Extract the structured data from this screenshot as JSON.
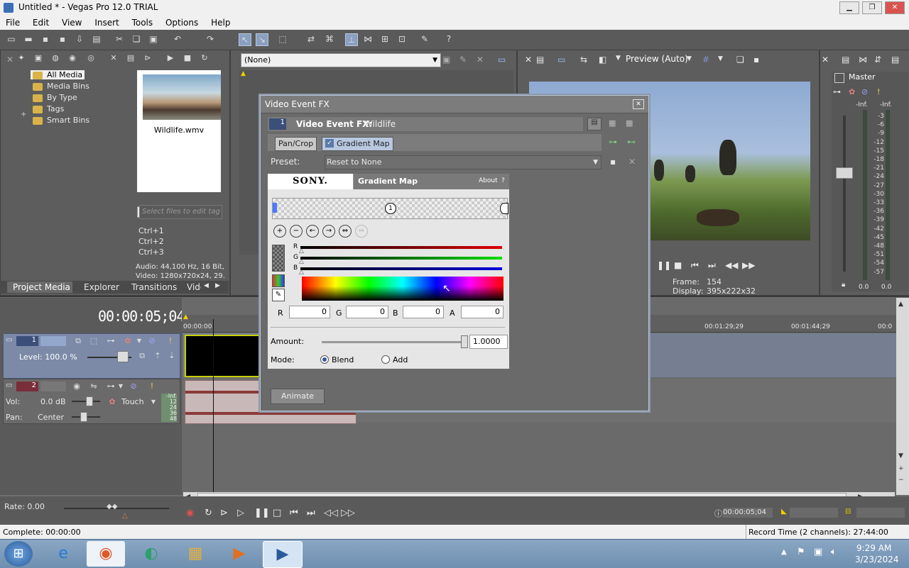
{
  "window": {
    "title": "Untitled * - Vegas Pro 12.0 TRIAL"
  },
  "menu": [
    "File",
    "Edit",
    "View",
    "Insert",
    "Tools",
    "Options",
    "Help"
  ],
  "media_tree": {
    "items": [
      "All Media",
      "Media Bins",
      "By Type",
      "Tags",
      "Smart Bins"
    ],
    "expand_sign": "+"
  },
  "media_thumb": {
    "filename": "Wildlife.wmv"
  },
  "media_tag_search": {
    "placeholder": "Select files to edit tag"
  },
  "shortcuts": [
    "Ctrl+1",
    "Ctrl+2",
    "Ctrl+3"
  ],
  "media_info": {
    "audio": "Audio: 44,100 Hz, 16 Bit,",
    "video": "Video: 1280x720x24, 29."
  },
  "window_tabs": [
    "Project Media",
    "Explorer",
    "Transitions",
    "Vide"
  ],
  "fx_dropdown": {
    "value": "(None)"
  },
  "preview": {
    "quality": "Preview (Auto)",
    "frame_label": "Frame:",
    "frame_value": "154",
    "display_label": "Display:",
    "display_value": "395x222x32"
  },
  "master": {
    "label": "Master",
    "inf_left": "-Inf.",
    "inf_right": "-Inf.",
    "scale": [
      "3",
      "6",
      "9",
      "12",
      "15",
      "18",
      "21",
      "24",
      "27",
      "30",
      "33",
      "36",
      "39",
      "42",
      "45",
      "48",
      "51",
      "54",
      "57"
    ],
    "bottom_left": "0.0",
    "bottom_right": "0.0"
  },
  "timeline": {
    "timecode": "00:00:05;04",
    "ruler": [
      "00:00:00",
      "00:01:29;29",
      "00:01:44;29",
      "00:0"
    ],
    "track1": {
      "number": "1",
      "level": "Level: 100.0 %"
    },
    "track2": {
      "number": "2",
      "vol_label": "Vol:",
      "vol_value": "0.0 dB",
      "pan_label": "Pan:",
      "pan_value": "Center",
      "touch": "Touch",
      "meter_values": [
        "-Inf.",
        "12",
        "24",
        "36",
        "48"
      ]
    },
    "rate": "Rate: 0.00",
    "transport_time": "00:00:05;04"
  },
  "status": {
    "complete": "Complete: 00:00:00",
    "record_time": "Record Time (2 channels): 27:44:00"
  },
  "fx_dialog": {
    "title": "Video Event FX",
    "header_label": "Video Event FX:",
    "header_value": "Wildlife",
    "track_number": "1",
    "chain": [
      "Pan/Crop",
      "Gradient Map"
    ],
    "preset_label": "Preset:",
    "preset_value": "Reset to None",
    "brand": "SONY.",
    "plugin_name": "Gradient Map",
    "about": "About",
    "about_q": "?",
    "marker": "1",
    "channel_letters": [
      "R",
      "G",
      "B"
    ],
    "rgba_labels": [
      "R",
      "G",
      "B",
      "A"
    ],
    "rgba_values": [
      "0",
      "0",
      "0",
      "0"
    ],
    "amount_label": "Amount:",
    "amount_value": "1.0000",
    "amount": 1.0,
    "mode_label": "Mode:",
    "modes": [
      "Blend",
      "Add"
    ],
    "mode_selected": "Blend",
    "animate": "Animate"
  },
  "taskbar": {
    "time": "9:29 AM",
    "date": "3/23/2024"
  }
}
